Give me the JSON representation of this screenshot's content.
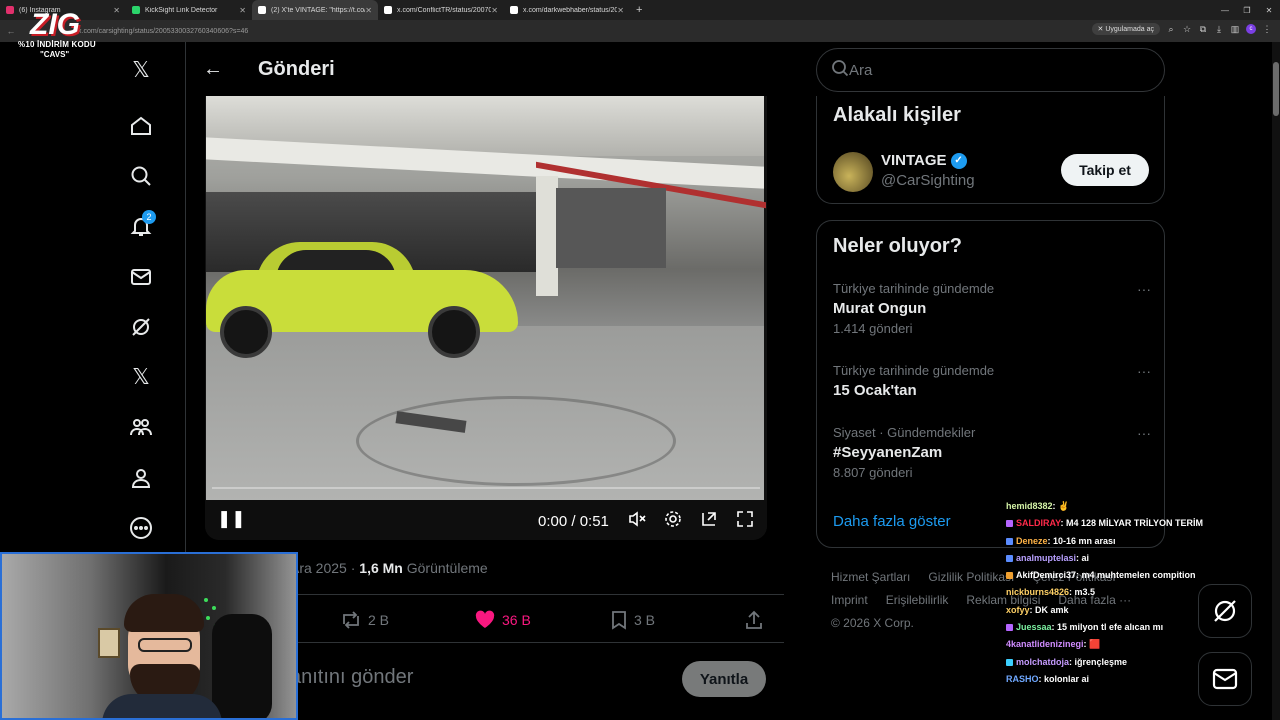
{
  "browser": {
    "tabs": [
      {
        "label": "(6) Instagram",
        "color": "#e1306c",
        "active": false
      },
      {
        "label": "KickSight Link Detector",
        "color": "#2bd46b",
        "active": false
      },
      {
        "label": "(2) X'te VINTAGE: \"https://t.co/...",
        "color": "#ffffff",
        "active": true
      },
      {
        "label": "x.com/ConflictTR/status/20070...",
        "color": "#ffffff",
        "active": false
      },
      {
        "label": "x.com/darkwebhaber/status/20...",
        "color": "#ffffff",
        "active": false
      }
    ],
    "url": "x.com/carsighting/status/2005330032760340606?s=46",
    "app_pill": "Uygulamada aç"
  },
  "overlay_logo": {
    "brand": "ZIG",
    "promo": "%10 İNDİRİM KODU",
    "code": "\"CAVS\""
  },
  "sidebar": {
    "notification_count": "2"
  },
  "header": {
    "title": "Gönderi",
    "back_icon": "arrow-left-icon"
  },
  "video": {
    "time": "0:00 / 0:51",
    "progress": 0.0
  },
  "post": {
    "date_fragment": "Ara 2025",
    "views_count": "1,6 Mn",
    "views_label": "Görüntüleme",
    "reposts": "2 B",
    "likes": "36 B",
    "bookmarks": "3 B",
    "like_color": "#f91880",
    "reply_placeholder": "anıtını gönder",
    "reply_button": "Yanıtla"
  },
  "search": {
    "placeholder": "Ara"
  },
  "relevant": {
    "title": "Alakalı kişiler",
    "name": "VINTAGE",
    "handle": "@CarSighting",
    "follow": "Takip et"
  },
  "trends": {
    "title": "Neler oluyor?",
    "items": [
      {
        "context": "Türkiye tarihinde gündemde",
        "name": "Murat Ongun",
        "count": "1.414 gönderi"
      },
      {
        "context": "Türkiye tarihinde gündemde",
        "name": "15 Ocak'tan",
        "count": ""
      },
      {
        "context": "Siyaset · Gündemdekiler",
        "name": "#SeyyanenZam",
        "count": "8.807 gönderi"
      }
    ],
    "show_more": "Daha fazla göster"
  },
  "footer": {
    "terms": "Hizmet Şartları",
    "privacy": "Gizlilik Politikası",
    "cookies": "Çerez Politikası",
    "imprint": "Imprint",
    "accessibility": "Erişilebilirlik",
    "ads": "Reklam bilgisi",
    "more": "Daha fazla ···",
    "copyright": "© 2026 X Corp."
  },
  "chat": [
    {
      "user": "hemid8382",
      "msg": ": ✌",
      "color": "#d6f5a8",
      "badge": ""
    },
    {
      "user": "SALDIRAY",
      "msg": ": M4 128 MİLYAR TRİLYON TERİM",
      "color": "#ff2a4a",
      "badge": "#b565ff"
    },
    {
      "user": "Deneze",
      "msg": ": 10-16 mn arası",
      "color": "#ffb347",
      "badge": "#5b8cff"
    },
    {
      "user": "analmuptelasi",
      "msg": ": ai",
      "color": "#b8a0ff",
      "badge": "#5b8cff"
    },
    {
      "user": "AkifDemirci37",
      "msg": ": m4 muhtemelen compition",
      "color": "#ffffff",
      "badge": "#f0a030"
    },
    {
      "user": "nickburns4826",
      "msg": ": m3.5",
      "color": "#ffd166",
      "badge": ""
    },
    {
      "user": "xofyy",
      "msg": ": DK amk",
      "color": "#ffd166",
      "badge": ""
    },
    {
      "user": "Juessaa",
      "msg": ": 15 milyon tl efe alıcan mı",
      "color": "#7bf0a0",
      "badge": "#b565ff"
    },
    {
      "user": "4kanatlidenizinegi",
      "msg": ": 🟥",
      "color": "#d08cff",
      "badge": ""
    },
    {
      "user": "molchatdoja",
      "msg": ": iğrençleşme",
      "color": "#c69cff",
      "badge": "#3ccfff"
    },
    {
      "user": "RASHO",
      "msg": ": kolonlar ai",
      "color": "#6fa8ff",
      "badge": ""
    }
  ]
}
